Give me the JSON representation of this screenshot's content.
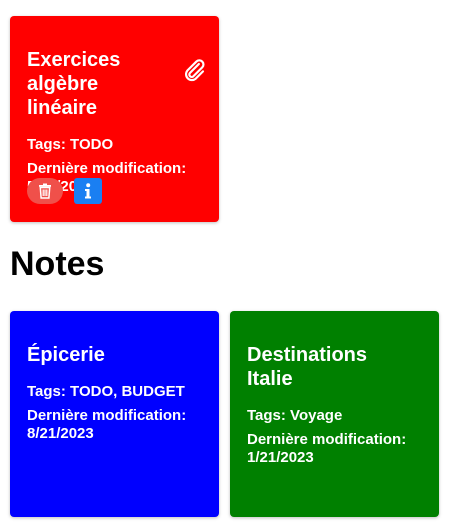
{
  "pinned_cards": [
    {
      "title": "Exercices algèbre linéaire",
      "tags_label": "Tags: TODO",
      "modified_label": "Dernière modification:",
      "modified_date": "5/21/2023",
      "color": "#ff0000",
      "has_attachment": true,
      "actions": [
        "trash-icon",
        "info-icon"
      ]
    }
  ],
  "notes_section": {
    "heading": "Notes",
    "cards": [
      {
        "title": "Épicerie",
        "tags_label": "Tags: TODO, BUDGET",
        "modified_label": "Dernière modification:",
        "modified_date": "8/21/2023",
        "color": "#0000ff"
      },
      {
        "title": "Destinations Italie",
        "tags_label": "Tags: Voyage",
        "modified_label": "Dernière modification:",
        "modified_date": "1/21/2023",
        "color": "#008000"
      }
    ]
  }
}
